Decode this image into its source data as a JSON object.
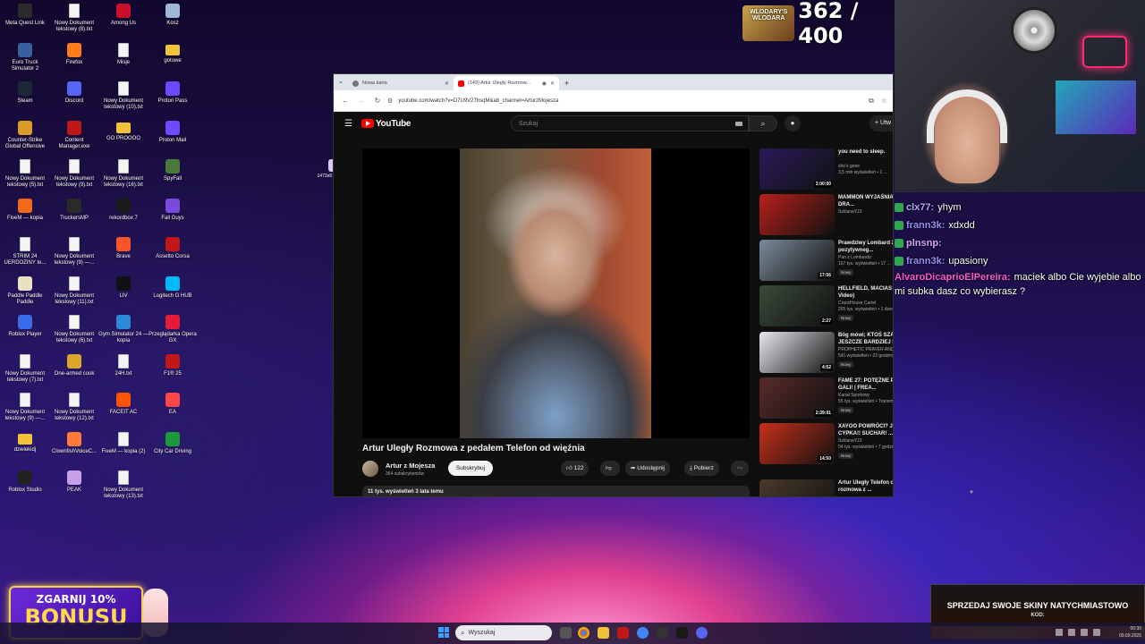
{
  "desktop_icons": [
    {
      "label": "Meta Quest Link",
      "color": "#2b2b2b"
    },
    {
      "label": "Nowy Dokument tekstowy (8).txt",
      "color": "txt"
    },
    {
      "label": "Among Us",
      "color": "#c8102e"
    },
    {
      "label": "Kosz",
      "color": "#9fb8d8"
    },
    {
      "label": "Euro Truck Simulator 2",
      "color": "#3a5fa0"
    },
    {
      "label": "Firefox",
      "color": "#ff7a1a"
    },
    {
      "label": "Misje",
      "color": "txt"
    },
    {
      "label": "gotowe",
      "color": "folder"
    },
    {
      "label": "Steam",
      "color": "#1b2838"
    },
    {
      "label": "Discord",
      "color": "#5865f2"
    },
    {
      "label": "Nowy Dokument tekstowy (10).txt",
      "color": "txt"
    },
    {
      "label": "Proton Pass",
      "color": "#6d4aff"
    },
    {
      "label": "Counter-Strike Global Offensive",
      "color": "#d89a2a"
    },
    {
      "label": "Content Manager.exe",
      "color": "#c01818"
    },
    {
      "label": "GO PROOOO",
      "color": "folder"
    },
    {
      "label": "Proton Mail",
      "color": "#6d4aff"
    },
    {
      "label": "Nowy Dokument tekstowy (5).txt",
      "color": "txt"
    },
    {
      "label": "Nowy Dokument tekstowy (9).txt",
      "color": "txt"
    },
    {
      "label": "Nowy Dokument tekstowy (16).txt",
      "color": "txt"
    },
    {
      "label": "SpyFall",
      "color": "#4a7a3a"
    },
    {
      "label": "FiveM — kopia",
      "color": "#f06a1a"
    },
    {
      "label": "TruckersMP",
      "color": "#2a2a2a"
    },
    {
      "label": "rekordbox 7",
      "color": "#1a1a1a"
    },
    {
      "label": "Fall Guys",
      "color": "#7a4adc"
    },
    {
      "label": "STRIM 24 UERDOZINY te...",
      "color": "txt"
    },
    {
      "label": "Nowy Dokument tekstowy (9) —...",
      "color": "txt"
    },
    {
      "label": "Brave",
      "color": "#fb542b"
    },
    {
      "label": "Assetto Corsa",
      "color": "#c01818"
    },
    {
      "label": "Paddle Paddle Paddle",
      "color": "#e8e0c0"
    },
    {
      "label": "Nowy Dokument tekstowy (11).txt",
      "color": "txt"
    },
    {
      "label": "LIV",
      "color": "#111111"
    },
    {
      "label": "Logitech G HUB",
      "color": "#00b8fc"
    },
    {
      "label": "Roblox Player",
      "color": "#3a6ae8"
    },
    {
      "label": "Nowy Dokument tekstowy (6).txt",
      "color": "txt"
    },
    {
      "label": "Gym Simulator 24 — kopia",
      "color": "#2a8ad8"
    },
    {
      "label": "Przeglądarka Opera GX",
      "color": "#e81a3a"
    },
    {
      "label": "Nowy Dokument tekstowy (7).txt",
      "color": "txt"
    },
    {
      "label": "One-armed cook",
      "color": "#d8a82a"
    },
    {
      "label": "24H.txt",
      "color": "txt"
    },
    {
      "label": "F1® 25",
      "color": "#c01818"
    },
    {
      "label": "Nowy Dokument tekstowy (9) —...",
      "color": "txt"
    },
    {
      "label": "Nowy Dokument tekstowy (12).txt",
      "color": "txt"
    },
    {
      "label": "FACEIT AC",
      "color": "#ff5500"
    },
    {
      "label": "EA",
      "color": "#ff4747"
    },
    {
      "label": "dzwiekidj",
      "color": "folder"
    },
    {
      "label": "ClownfishVoiceC...",
      "color": "#ff7a3a"
    },
    {
      "label": "FiveM — kopia (2)",
      "color": "txt"
    },
    {
      "label": "City Car Driving",
      "color": "#1a9a3a"
    },
    {
      "label": "Roblox Studio",
      "color": "#222222"
    },
    {
      "label": "PEAK",
      "color": "#c8a0e8"
    },
    {
      "label": "Nowy Dokument tekstowy (13).txt",
      "color": "txt"
    }
  ],
  "desktop_file": "1472e57c-6d87...",
  "overlay": {
    "counter_logo": "WLODARY'S WLODARA",
    "counter": "362 / 400",
    "sponsor_line1": "ZGARNIJ 10%",
    "sponsor_line2": "BONUSU",
    "skins_line1": "SPRZEDAJ SWOJE SKINY NATYCHMIASTOWO",
    "skins_line2": "KOD:"
  },
  "chat": [
    {
      "user": "clx77:",
      "msg": "yhym",
      "color": "#b8a4ff"
    },
    {
      "user": "frann3k:",
      "msg": "xdxdd",
      "color": "#9a8cff"
    },
    {
      "user": "plnsnp:",
      "msg": "",
      "color": "#d8a0ff"
    },
    {
      "user": "frann3k:",
      "msg": "upasiony",
      "color": "#9a8cff"
    },
    {
      "user": "AlvaroDicaprioElPereira:",
      "msg": "maciek albo Cie wyjebie albo mi subka dasz co wybierasz ?",
      "color": "#ff5ad8"
    }
  ],
  "browser": {
    "tabs": [
      {
        "label": "Nowa karta",
        "active": false
      },
      {
        "label": "(149) Artur Ulegly Rozmow...",
        "active": true
      }
    ],
    "url": "youtube.com/watch?v=D7U9V27hsqM&ab_channel=ArturzMojesza"
  },
  "youtube": {
    "logo": "YouTube",
    "search_placeholder": "Szukaj",
    "create_label": "Utw",
    "video_title": "Artur Uległy Rozmowa z pedałem Telefon od więźnia",
    "channel_name": "Artur z Mojesza",
    "channel_subs": "364 subskrybentów",
    "subscribe": "Subskrybuj",
    "likes": "122",
    "share": "Udostępnij",
    "download": "Pobierz",
    "views_date": "11 tys. wyświetleń  3 lata temu"
  },
  "recommendations": [
    {
      "title": "you need to sleep.",
      "channel": "she's gone",
      "views": "3,5 mln wyświetleń • 1 ...",
      "duration": "3:00:00",
      "new": "",
      "thumb": "#2a1a5a"
    },
    {
      "title": "MAMMON WYJAŚNIA STREAMERÓW!? DRA...",
      "channel": "SzklanaY2J",
      "views": "",
      "duration": "",
      "new": "",
      "thumb": "#b8201a"
    },
    {
      "title": "Prawdziwy Lombard 285 \"Nic pozytywneg...",
      "channel": "Pan z Lombardu",
      "views": "167 tys. wyświetleń • 17 ...",
      "duration": "17:56",
      "new": "Nowy",
      "thumb": "#7a8a9a"
    },
    {
      "title": "HELLFIELD, MACIAS RMX (Official Video)",
      "channel": "CrackHouse Cartel",
      "views": "265 tys. wyświetleń • 1 dzień temu",
      "duration": "2:27",
      "new": "Nowy",
      "thumb": "#3a4a3a"
    },
    {
      "title": "Bóg mówi; KTOŚ SZANUJE CIĘ JESZCZE BARDZIEJ DZIĘKI ...",
      "channel": "PROPHETIC PRAYER AND COUNSELING ...",
      "views": "541 wyświetleń • 23 godziny temu",
      "duration": "4:52",
      "new": "Nowy",
      "thumb": "#e8e8f0"
    },
    {
      "title": "FAME 27: POTĘŻNE PODSUMOWANIE GALI! | FREA...",
      "channel": "Kanał Sportowy",
      "views": "55 tys. wyświetleń • Transmisja odbyła s...",
      "duration": "2:39:01",
      "new": "Nowy",
      "thumb": "#5a2a2a"
    },
    {
      "title": "XAYOO POWRÓCI? JAPCZAN I PŁACZ CYPKA!! SUCHAR! ...",
      "channel": "SzklanaY2J",
      "views": "54 tys. wyświetleń • 7 godzin temu",
      "duration": "14:50",
      "new": "Nowy",
      "thumb": "#c8301a"
    },
    {
      "title": "Artur Uległy  Telefon od developera  rozmowa z ...",
      "channel": "",
      "views": "",
      "duration": "",
      "new": "",
      "thumb": "#4a3a2a"
    }
  ],
  "taskbar": {
    "search_placeholder": "Wyszukaj",
    "time": "00:30",
    "date": "09.09.2025"
  }
}
